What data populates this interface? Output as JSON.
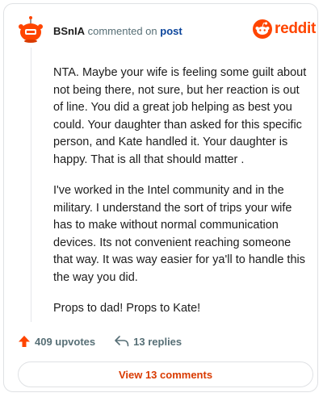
{
  "comment": {
    "username": "BSnIA",
    "commented_on": "commented on",
    "post_link": "post",
    "paragraphs": [
      "NTA. Maybe your wife is feeling some guilt about not being there, not sure, but her reaction is out of line. You did a great job helping as best you could. Your daughter than asked for this specific person, and Kate handled it. Your daughter is happy. That is all that should matter .",
      "I've worked in the Intel community and in the military. I understand the sort of trips your wife has to make without normal communication devices. Its not convenient reaching someone that way. It was way easier for ya'll to handle this the way you did.",
      "Props to dad! Props to Kate!"
    ]
  },
  "brand": {
    "name": "reddit",
    "color": "#ff4500"
  },
  "actions": {
    "upvotes": "409 upvotes",
    "replies": "13 replies"
  },
  "view_comments_label": "View 13 comments",
  "icons": {
    "avatar": "snoo-avatar-icon",
    "logo": "reddit-logo-icon",
    "upvote": "upvote-arrow-icon",
    "reply": "reply-arrow-icon"
  }
}
